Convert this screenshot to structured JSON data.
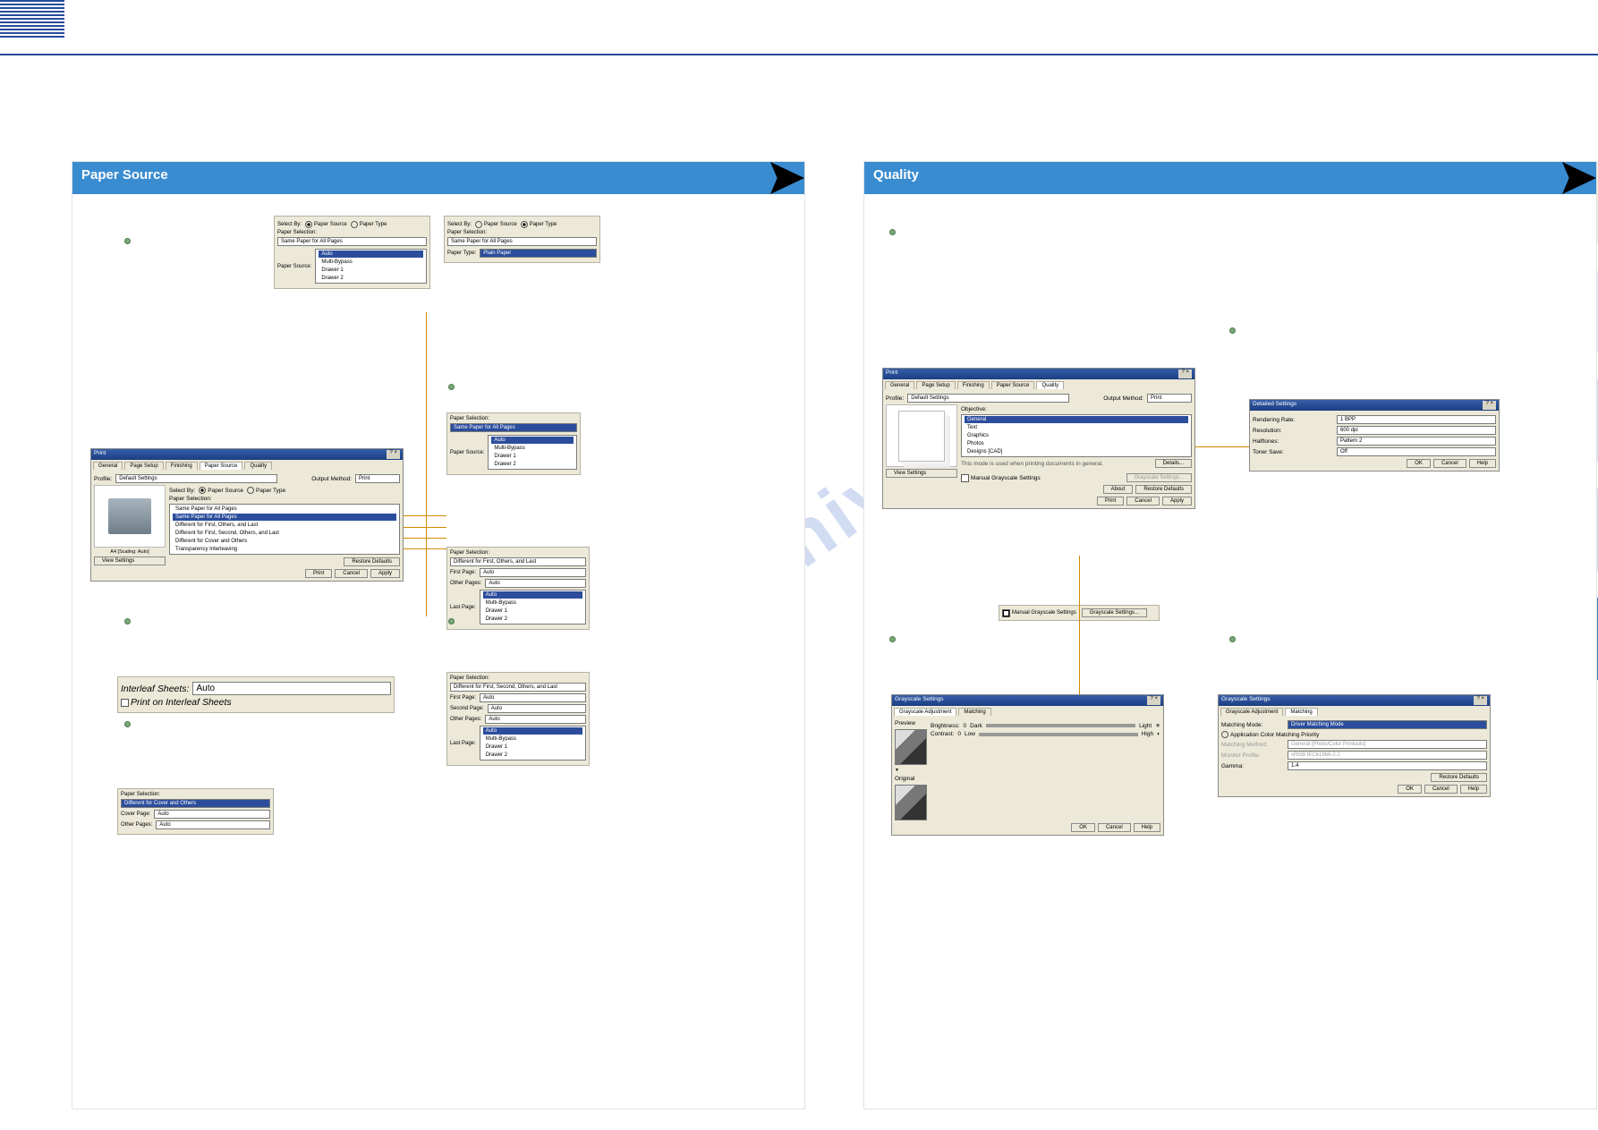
{
  "header": {
    "stripe": "decorative-lines"
  },
  "sidetabs": [
    "pale1",
    "pale2",
    "pale3",
    "pale4",
    "active"
  ],
  "left_panel": {
    "ribbon_title": "Paper Source",
    "main_dialog": {
      "title": "Print",
      "tabs": [
        "General",
        "Page Setup",
        "Finishing",
        "Paper Source",
        "Quality"
      ],
      "profile_label": "Profile:",
      "profile_value": "Default Settings",
      "output_method_label": "Output Method:",
      "output_method_value": "Print",
      "select_by_label": "Select By:",
      "select_by_paper_source": "Paper Source",
      "select_by_paper_type": "Paper Type",
      "paper_selection_label": "Paper Selection:",
      "paper_selection_options": [
        "Same Paper for All Pages",
        "Same Paper for All Pages",
        "Different for First, Others, and Last",
        "Different for First, Second, Others, and Last",
        "Different for Cover and Others",
        "Transparency Interleaving"
      ],
      "preview_label": "A4 [Scaling: Auto]",
      "view_settings_btn": "View Settings",
      "restore_defaults_btn": "Restore Defaults",
      "print_btn": "Print",
      "cancel_btn": "Cancel",
      "apply_btn": "Apply"
    },
    "frag_top_a": {
      "select_by_label": "Select By:",
      "paper_source": "Paper Source",
      "paper_type": "Paper Type",
      "paper_selection_label": "Paper Selection:",
      "paper_selection_value": "Same Paper for All Pages",
      "paper_source_label": "Paper Source:",
      "paper_sources": [
        "Auto",
        "Multi-Bypass",
        "Drawer 1",
        "Drawer 2"
      ]
    },
    "frag_top_b": {
      "select_by_label": "Select By:",
      "paper_source": "Paper Source",
      "paper_type": "Paper Type",
      "paper_selection_label": "Paper Selection:",
      "paper_selection_value": "Same Paper for All Pages",
      "paper_type_label": "Paper Type:",
      "paper_type_value": "Plain Paper"
    },
    "frag_mid_a": {
      "paper_selection_label": "Paper Selection:",
      "combo_value": "Same Paper for All Pages",
      "paper_source_label": "Paper Source:",
      "paper_sources": [
        "Auto",
        "Multi-Bypass",
        "Drawer 1",
        "Drawer 2"
      ]
    },
    "frag_mid_b": {
      "paper_selection_label": "Paper Selection:",
      "combo_value": "Different for First, Others, and Last",
      "first_page_label": "First Page:",
      "first_page_value": "Auto",
      "other_pages_label": "Other Pages:",
      "other_pages_value": "Auto",
      "last_page_label": "Last Page:",
      "last_page_values": [
        "Auto",
        "Multi-Bypass",
        "Drawer 1",
        "Drawer 2"
      ]
    },
    "frag_interleaf": {
      "interleaf_sheets_label": "Interleaf Sheets:",
      "interleaf_sheets_value": "Auto",
      "print_on_label": "Print on Interleaf Sheets"
    },
    "frag_mid_c": {
      "paper_selection_label": "Paper Selection:",
      "combo_value": "Different for First, Second, Others, and Last",
      "first_page_label": "First Page:",
      "first_page_value": "Auto",
      "second_page_label": "Second Page:",
      "second_page_value": "Auto",
      "other_pages_label": "Other Pages:",
      "other_pages_value": "Auto",
      "last_page_label": "Last Page:",
      "last_page_values": [
        "Auto",
        "Multi-Bypass",
        "Drawer 1",
        "Drawer 2"
      ]
    },
    "frag_bottom": {
      "paper_selection_label": "Paper Selection:",
      "combo_value": "Different for Cover and Others",
      "cover_page_label": "Cover Page:",
      "cover_page_value": "Auto",
      "other_pages_label": "Other Pages:",
      "other_pages_value": "Auto"
    }
  },
  "right_panel": {
    "ribbon_title": "Quality",
    "main_dialog": {
      "title": "Print",
      "tabs": [
        "General",
        "Page Setup",
        "Finishing",
        "Paper Source",
        "Quality"
      ],
      "profile_label": "Profile:",
      "profile_value": "Default Settings",
      "output_method_label": "Output Method:",
      "output_method_value": "Print",
      "objective_label": "Objective:",
      "objective_options": [
        "General",
        "Text",
        "Graphics",
        "Photos",
        "Designs [CAD]"
      ],
      "objective_hint": "This mode is used when printing documents in general.",
      "details_btn": "Details...",
      "manual_grayscale_label": "Manual Grayscale Settings",
      "grayscale_settings_btn": "Grayscale Settings...",
      "about_btn": "About",
      "restore_defaults_btn": "Restore Defaults",
      "view_settings_btn": "View Settings",
      "print_btn": "Print",
      "cancel_btn": "Cancel",
      "apply_btn": "Apply"
    },
    "frag_toggle": {
      "checkbox_label": "Manual Grayscale Settings",
      "btn_label": "Grayscale Settings..."
    },
    "detailed_settings": {
      "title": "Detailed Settings",
      "rendering_rate_label": "Rendering Rate:",
      "rendering_rate_value": "1 BPP",
      "resolution_label": "Resolution:",
      "resolution_value": "600 dpi",
      "halftones_label": "Halftones:",
      "halftones_value": "Pattern 2",
      "toner_save_label": "Toner Save:",
      "toner_save_value": "Off",
      "ok_btn": "OK",
      "cancel_btn": "Cancel",
      "help_btn": "Help"
    },
    "grayscale_a": {
      "title": "Grayscale Settings",
      "tabs": [
        "Grayscale Adjustment",
        "Matching"
      ],
      "preview_label": "Preview",
      "brightness_label": "Brightness:",
      "brightness_value": "0",
      "brightness_dark": "Dark",
      "brightness_light": "Light",
      "contrast_label": "Contrast:",
      "contrast_value": "0",
      "contrast_low": "Low",
      "contrast_high": "High",
      "original_label": "Original",
      "ok_btn": "OK",
      "cancel_btn": "Cancel",
      "help_btn": "Help"
    },
    "grayscale_b": {
      "title": "Grayscale Settings",
      "tabs": [
        "Grayscale Adjustment",
        "Matching"
      ],
      "matching_mode_label": "Matching Mode:",
      "matching_mode_value": "Driver Matching Mode",
      "app_color_label": "Application Color Matching Priority",
      "matching_method_label": "Matching Method:",
      "matching_method_value": "General [Photo/Color Printouts]",
      "monitor_profile_label": "Monitor Profile:",
      "monitor_profile_value": "sRGB IEC61966-2.1",
      "gamma_label": "Gamma:",
      "gamma_value": "1.4",
      "restore_defaults_btn": "Restore Defaults",
      "ok_btn": "OK",
      "cancel_btn": "Cancel",
      "help_btn": "Help"
    }
  },
  "watermark": "manualshive.com"
}
